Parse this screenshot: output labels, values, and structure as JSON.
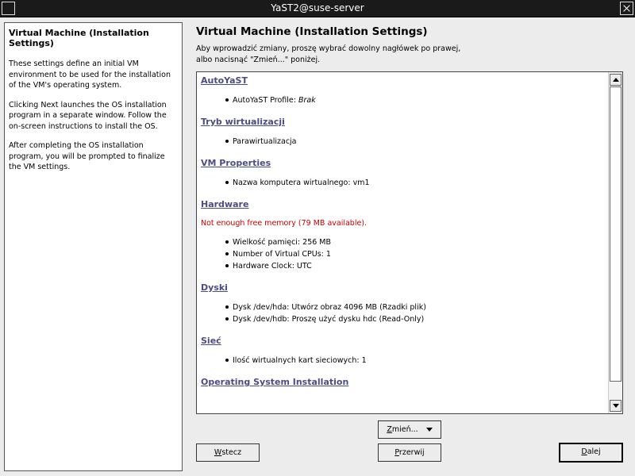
{
  "window": {
    "title": "YaST2@suse-server"
  },
  "help": {
    "title": "Virtual Machine (Installation Settings)",
    "paragraphs": [
      "These settings define an initial VM environment to be used for the installation of the VM's operating system.",
      "Clicking Next launches the OS installation program in a separate window. Follow the on-screen instructions to install the OS.",
      "After completing the OS installation program, you will be prompted to finalize the VM settings."
    ]
  },
  "main": {
    "title": "Virtual Machine (Installation Settings)",
    "subtitle_line1": "Aby wprowadzić zmiany, proszę wybrać dowolny nagłówek po prawej,",
    "subtitle_line2": "albo nacisnąć \"Zmień...\" poniżej."
  },
  "summary": {
    "autoyast": {
      "heading": "AutoYaST",
      "profile_label": "AutoYaST Profile: ",
      "profile_value": "Brak"
    },
    "virt": {
      "heading": "Tryb wirtualizacji",
      "item": "Parawirtualizacja"
    },
    "vmprops": {
      "heading": "VM Properties",
      "item": "Nazwa komputera wirtualnego: vm1"
    },
    "hardware": {
      "heading": "Hardware",
      "warning": "Not enough free memory (79 MB available).",
      "items": [
        "Wielkość pamięci: 256 MB",
        "Number of Virtual CPUs: 1",
        "Hardware Clock: UTC"
      ]
    },
    "disks": {
      "heading": "Dyski",
      "items": [
        "Dysk /dev/hda: Utwórz obraz 4096 MB (Rzadki plik)",
        "Dysk /dev/hdb: Proszę użyć dysku hdc (Read-Only)"
      ]
    },
    "network": {
      "heading": "Sieć",
      "item": "Ilość wirtualnych kart sieciowych: 1"
    },
    "os": {
      "heading": "Operating System Installation"
    }
  },
  "buttons": {
    "change": {
      "mnemonic": "Z",
      "rest": "mień..."
    },
    "back": {
      "mnemonic": "W",
      "rest": "stecz"
    },
    "abort": {
      "mnemonic": "P",
      "rest": "rzerwij"
    },
    "next": {
      "mnemonic": "D",
      "rest": "alej"
    }
  }
}
